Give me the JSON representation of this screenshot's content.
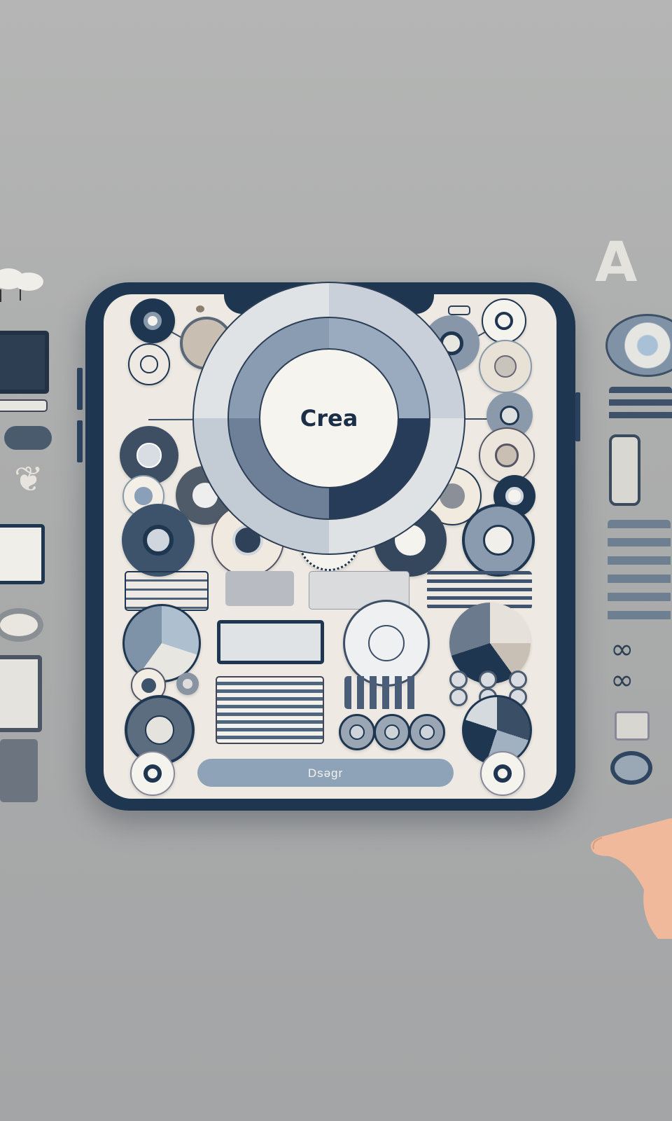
{
  "hub": {
    "label": "Crea",
    "icon": "radial-hub-icon"
  },
  "cta": {
    "label": "Dsəgr"
  },
  "colors": {
    "frame": "#1f3650",
    "screen": "#eeeae3",
    "accent": "#8fa3b8",
    "navy": "#1c2f48",
    "background": "#aaabab"
  },
  "status_bar": {
    "left_icon": "dot-icon",
    "right_icon": "battery-icon"
  },
  "icons": [
    "target-icon",
    "camera-icon",
    "crosshair-icon",
    "card-icon",
    "keyhole-icon",
    "eye-icon",
    "cup-icon",
    "record-icon",
    "lens-icon",
    "tablet-icon",
    "toggle-icon",
    "square-icon",
    "note-icon",
    "capsule-icon",
    "ring-icon",
    "dial-icon",
    "compass-icon",
    "chat-icon",
    "frame-icon",
    "list-icon",
    "bar-icon",
    "window-icon",
    "menu-icon",
    "globe-icon",
    "monitor-icon",
    "radar-icon",
    "pie-icon",
    "list-panel-icon",
    "bars-icon",
    "dots-grid-icon",
    "disc-icon",
    "coin-icon",
    "gauge-icon"
  ]
}
